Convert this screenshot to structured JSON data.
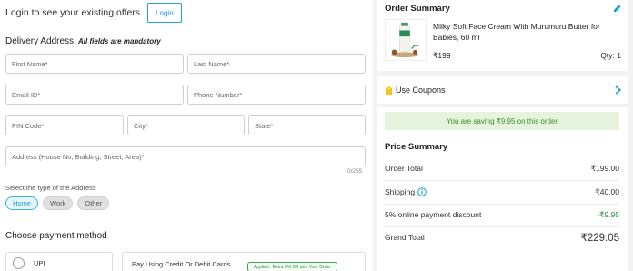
{
  "login": {
    "prompt": "Login to see your existing offers",
    "button": "Login"
  },
  "delivery": {
    "title": "Delivery Address",
    "note": "All fields are mandatory",
    "fields": {
      "first_name": "First Name*",
      "last_name": "Last Name*",
      "email": "Email ID*",
      "phone": "Phone Number*",
      "pin": "PIN Code*",
      "city": "City*",
      "state": "State*",
      "address": "Address (House No, Building, Street, Area)*"
    },
    "char_counter": "0/255",
    "address_type_label": "Select the type of the Address",
    "address_types": [
      "Home",
      "Work",
      "Other"
    ],
    "selected_address_type": "Home"
  },
  "payment": {
    "title": "Choose payment method",
    "upi_label": "UPI",
    "card_label": "Pay Using Credit Or Debit Cards",
    "card_badge": "Applied : Extra 5% Off with Your Order"
  },
  "order_summary": {
    "title": "Order Summary",
    "product": {
      "name": "Milky Soft Face Cream With Murumuru Butter for Babies, 60 ml",
      "price": "₹199",
      "qty": "Qty: 1"
    }
  },
  "coupons": {
    "label": "Use Coupons"
  },
  "savings_banner": "You are saving ₹9.95 on this order",
  "price_summary": {
    "title": "Price Summary",
    "rows": [
      {
        "label": "Order Total",
        "value": "₹199.00"
      },
      {
        "label": "Shipping",
        "value": "₹40.00"
      },
      {
        "label": "5% online payment discount",
        "value": "-₹9.95"
      }
    ],
    "grand_total": {
      "label": "Grand Total",
      "value": "₹229.05"
    }
  },
  "colors": {
    "accent": "#1f9bd0",
    "saving_green": "#2e8b3a",
    "saving_bg": "#e6f3dd",
    "coupon_yellow": "#f5c518"
  },
  "icons": [
    "edit-icon",
    "coupon-icon",
    "chevron-right-icon",
    "info-icon",
    "radio-icon"
  ]
}
